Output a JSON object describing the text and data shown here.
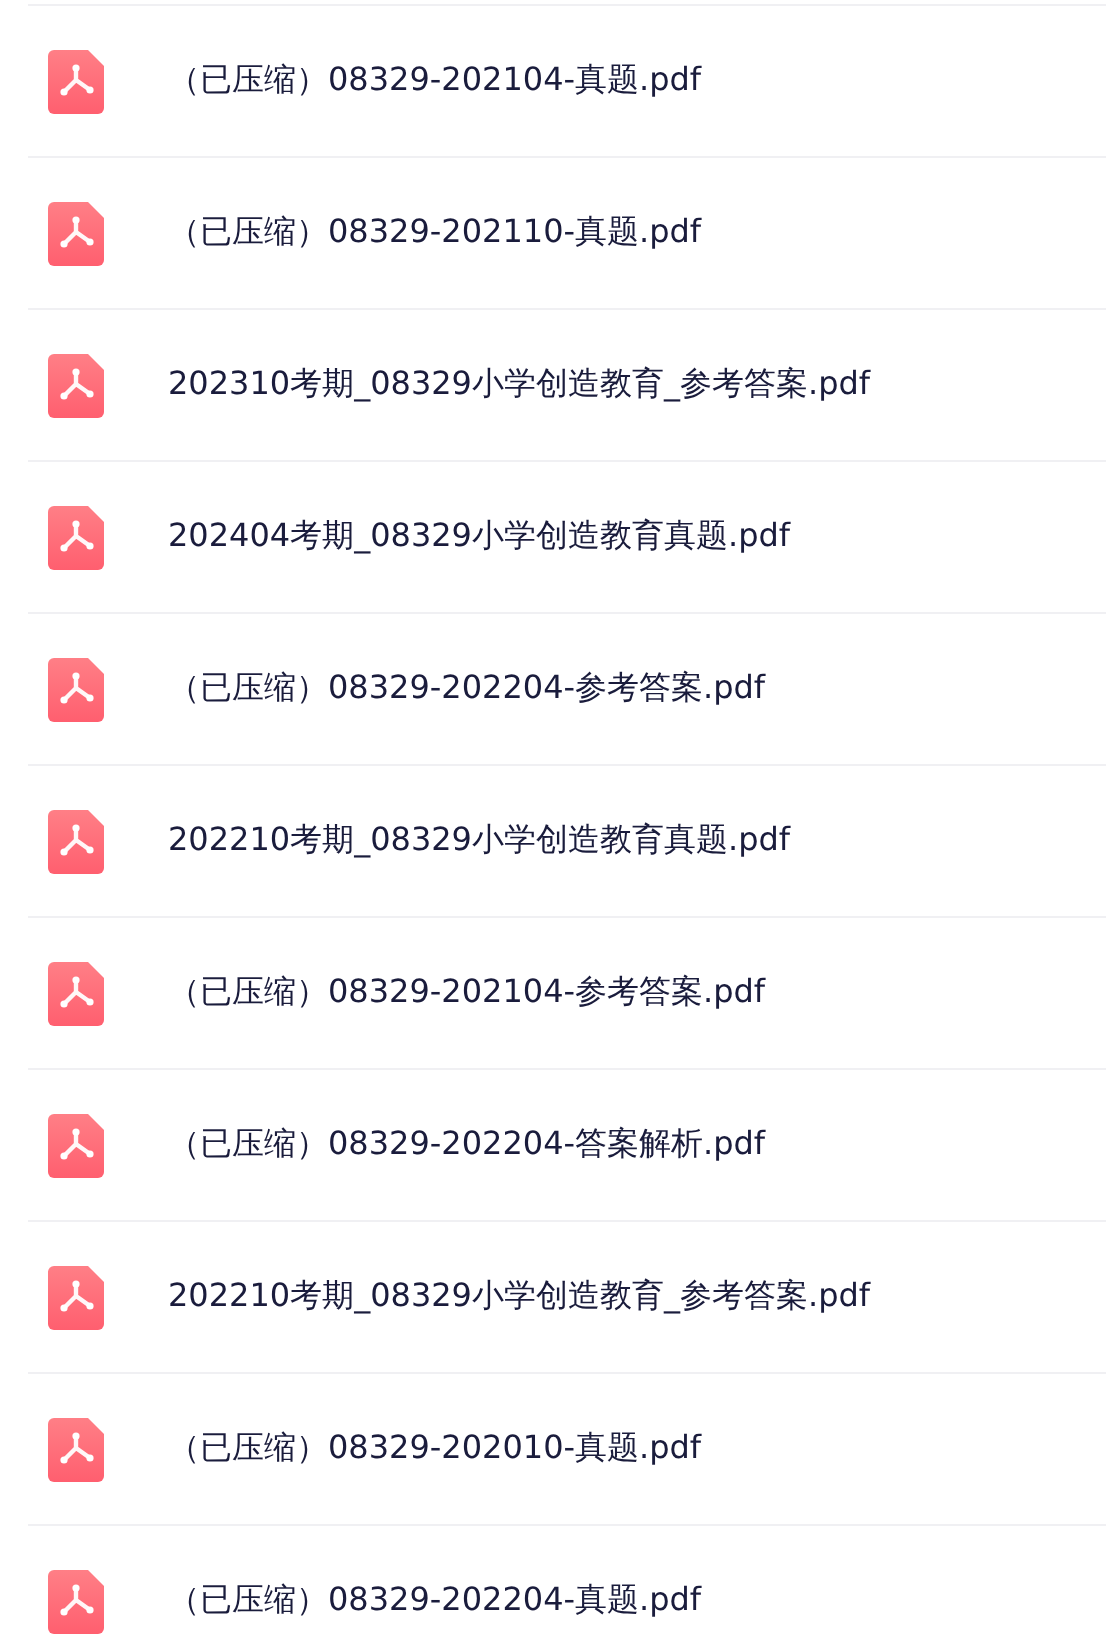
{
  "files": [
    {
      "name": "（已压缩）08329-202104-真题.pdf"
    },
    {
      "name": "（已压缩）08329-202110-真题.pdf"
    },
    {
      "name": "202310考期_08329小学创造教育_参考答案.pdf"
    },
    {
      "name": "202404考期_08329小学创造教育真题.pdf"
    },
    {
      "name": "（已压缩）08329-202204-参考答案.pdf"
    },
    {
      "name": "202210考期_08329小学创造教育真题.pdf"
    },
    {
      "name": "（已压缩）08329-202104-参考答案.pdf"
    },
    {
      "name": "（已压缩）08329-202204-答案解析.pdf"
    },
    {
      "name": "202210考期_08329小学创造教育_参考答案.pdf"
    },
    {
      "name": "（已压缩）08329-202010-真题.pdf"
    },
    {
      "name": "（已压缩）08329-202204-真题.pdf"
    }
  ]
}
